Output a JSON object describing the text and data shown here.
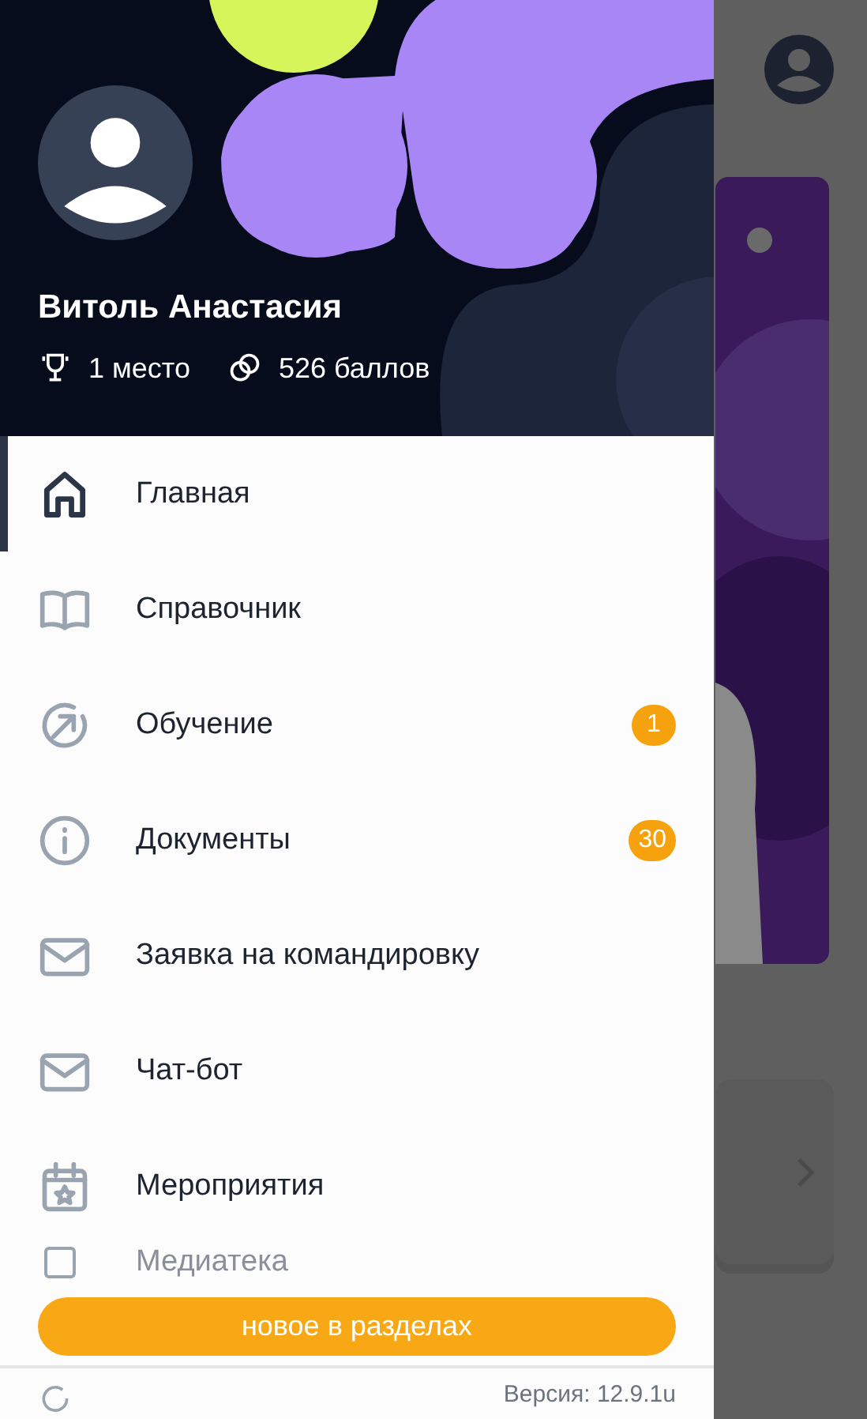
{
  "profile": {
    "name": "Витоль Анастасия",
    "rank": "1 место",
    "points": "526 баллов"
  },
  "menu": [
    {
      "label": "Главная",
      "selected": true
    },
    {
      "label": "Справочник",
      "selected": false
    },
    {
      "label": "Обучение",
      "selected": false,
      "badge": "1"
    },
    {
      "label": "Документы",
      "selected": false,
      "badge": "30"
    },
    {
      "label": "Заявка на командировку",
      "selected": false
    },
    {
      "label": "Чат-бот",
      "selected": false
    },
    {
      "label": "Мероприятия",
      "selected": false
    },
    {
      "label": "Медиатека",
      "selected": false
    }
  ],
  "new_button": "новое в разделах",
  "footer": {
    "version": "Версия: 12.9.1u"
  }
}
